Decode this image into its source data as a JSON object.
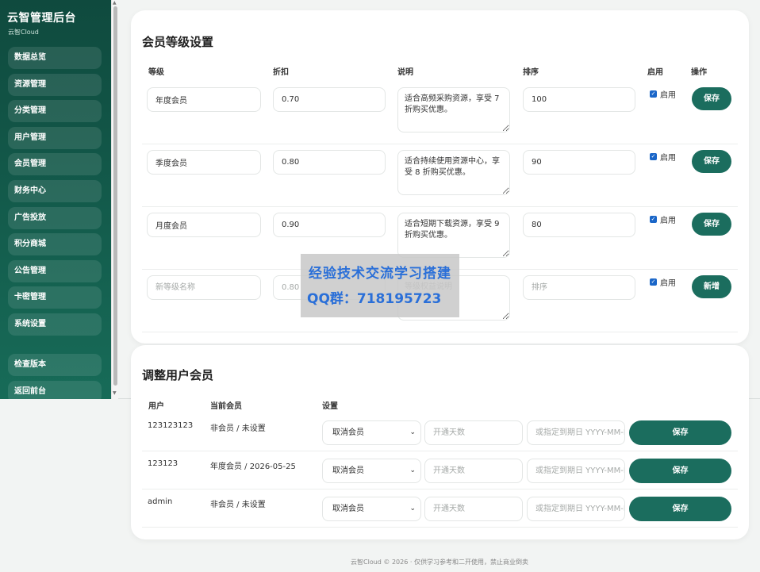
{
  "sidebar": {
    "title": "云智管理后台",
    "subtitle": "云智Cloud",
    "items": [
      {
        "label": "数据总览"
      },
      {
        "label": "资源管理"
      },
      {
        "label": "分类管理"
      },
      {
        "label": "用户管理"
      },
      {
        "label": "会员管理"
      },
      {
        "label": "财务中心"
      },
      {
        "label": "广告投放"
      },
      {
        "label": "积分商城"
      },
      {
        "label": "公告管理"
      },
      {
        "label": "卡密管理"
      },
      {
        "label": "系统设置"
      }
    ],
    "bottom_items": [
      {
        "label": "检查版本"
      },
      {
        "label": "返回前台"
      }
    ]
  },
  "levels_card": {
    "title": "会员等级设置",
    "headers": {
      "level": "等级",
      "discount": "折扣",
      "desc": "说明",
      "sort": "排序",
      "enabled": "启用",
      "action": "操作"
    },
    "rows": [
      {
        "name": "年度会员",
        "discount": "0.70",
        "desc": "适合高频采购资源，享受 7 折购买优惠。",
        "sort": "100",
        "enabled_label": "启用",
        "button": "保存"
      },
      {
        "name": "季度会员",
        "discount": "0.80",
        "desc": "适合持续使用资源中心，享受 8 折购买优惠。",
        "sort": "90",
        "enabled_label": "启用",
        "button": "保存"
      },
      {
        "name": "月度会员",
        "discount": "0.90",
        "desc": "适合短期下载资源，享受 9 折购买优惠。",
        "sort": "80",
        "enabled_label": "启用",
        "button": "保存"
      }
    ],
    "new_row": {
      "name_placeholder": "新等级名称",
      "discount_placeholder": "0.80",
      "desc_placeholder": "等级权益说明",
      "sort_placeholder": "排序",
      "enabled_label": "启用",
      "button": "新增"
    }
  },
  "users_card": {
    "title": "调整用户会员",
    "headers": {
      "user": "用户",
      "current": "当前会员",
      "settings": "设置"
    },
    "rows": [
      {
        "user": "123123123",
        "current": "非会员 / 未设置",
        "select": "取消会员",
        "days_placeholder": "开通天数",
        "date_placeholder": "或指定到期日 YYYY-MM-DD",
        "button": "保存"
      },
      {
        "user": "123123",
        "current": "年度会员 / 2026-05-25",
        "select": "取消会员",
        "days_placeholder": "开通天数",
        "date_placeholder": "或指定到期日 YYYY-MM-DD",
        "button": "保存"
      },
      {
        "user": "admin",
        "current": "非会员 / 未设置",
        "select": "取消会员",
        "days_placeholder": "开通天数",
        "date_placeholder": "或指定到期日 YYYY-MM-DD",
        "button": "保存"
      }
    ]
  },
  "watermark": {
    "line1": "经验技术交流学习搭建",
    "line2": "QQ群：718195723"
  },
  "footer": "云智Cloud © 2026 · 仅供学习参考和二开使用，禁止商业倒卖",
  "colors": {
    "sidebar_top": "#0f4a3e",
    "sidebar_bottom": "#176b58",
    "button": "#1b6d5e",
    "checkbox": "#1a66c8",
    "watermark_text": "#2a6fd8"
  }
}
